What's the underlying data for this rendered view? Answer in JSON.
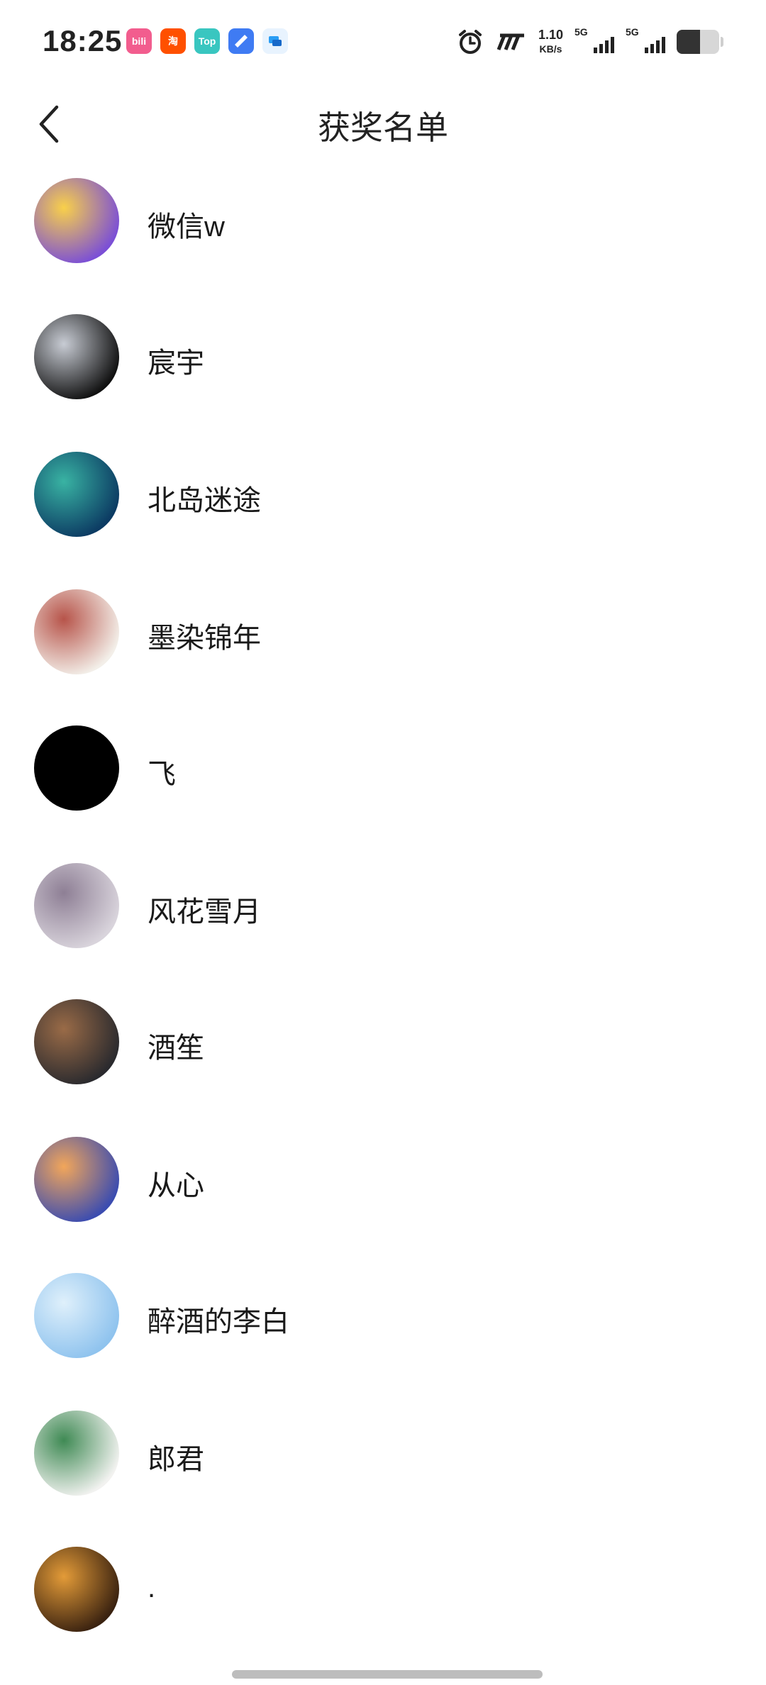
{
  "status_bar": {
    "time": "18:25",
    "apps": [
      {
        "icon": "bilibili-app-icon",
        "text": "bili",
        "color": "#f25d8e"
      },
      {
        "icon": "taobao-app-icon",
        "text": "淘",
        "color": "#ff5000"
      },
      {
        "icon": "top-app-icon",
        "text": "Top",
        "color": "#39c6c0"
      },
      {
        "icon": "browser-app-icon",
        "text": "",
        "color": "#3f7bf3"
      },
      {
        "icon": "chat-app-icon",
        "text": "",
        "color": "#2a9df4"
      }
    ],
    "net_speed_value": "1.10",
    "net_speed_unit": "KB/s",
    "sim1_label": "5G",
    "sim2_label": "5G",
    "battery_level": 0.55
  },
  "header": {
    "title": "获奖名单",
    "back_icon": "back-arrow-icon"
  },
  "winners": [
    {
      "name": "微信w",
      "avatar_colors": [
        "#7b4fd6",
        "#f9d04a"
      ]
    },
    {
      "name": "宸宇",
      "avatar_colors": [
        "#111111",
        "#c8ccd4"
      ]
    },
    {
      "name": "北岛迷途",
      "avatar_colors": [
        "#0c3b63",
        "#39b3a3"
      ]
    },
    {
      "name": "墨染锦年",
      "avatar_colors": [
        "#f3efe9",
        "#b7544a"
      ]
    },
    {
      "name": "飞",
      "avatar_colors": [
        "#000000",
        "#000000"
      ]
    },
    {
      "name": "风花雪月",
      "avatar_colors": [
        "#d9d4dc",
        "#8e7f95"
      ]
    },
    {
      "name": "酒笙",
      "avatar_colors": [
        "#2a2a2e",
        "#9a6b47"
      ]
    },
    {
      "name": "从心",
      "avatar_colors": [
        "#3b4cb0",
        "#f2a65a"
      ]
    },
    {
      "name": "醉酒的李白",
      "avatar_colors": [
        "#8fc3ee",
        "#dff0fb"
      ]
    },
    {
      "name": "郎君",
      "avatar_colors": [
        "#f2f2f0",
        "#3f8a54"
      ]
    },
    {
      "name": ".",
      "avatar_colors": [
        "#3a2210",
        "#e39b38"
      ]
    }
  ]
}
